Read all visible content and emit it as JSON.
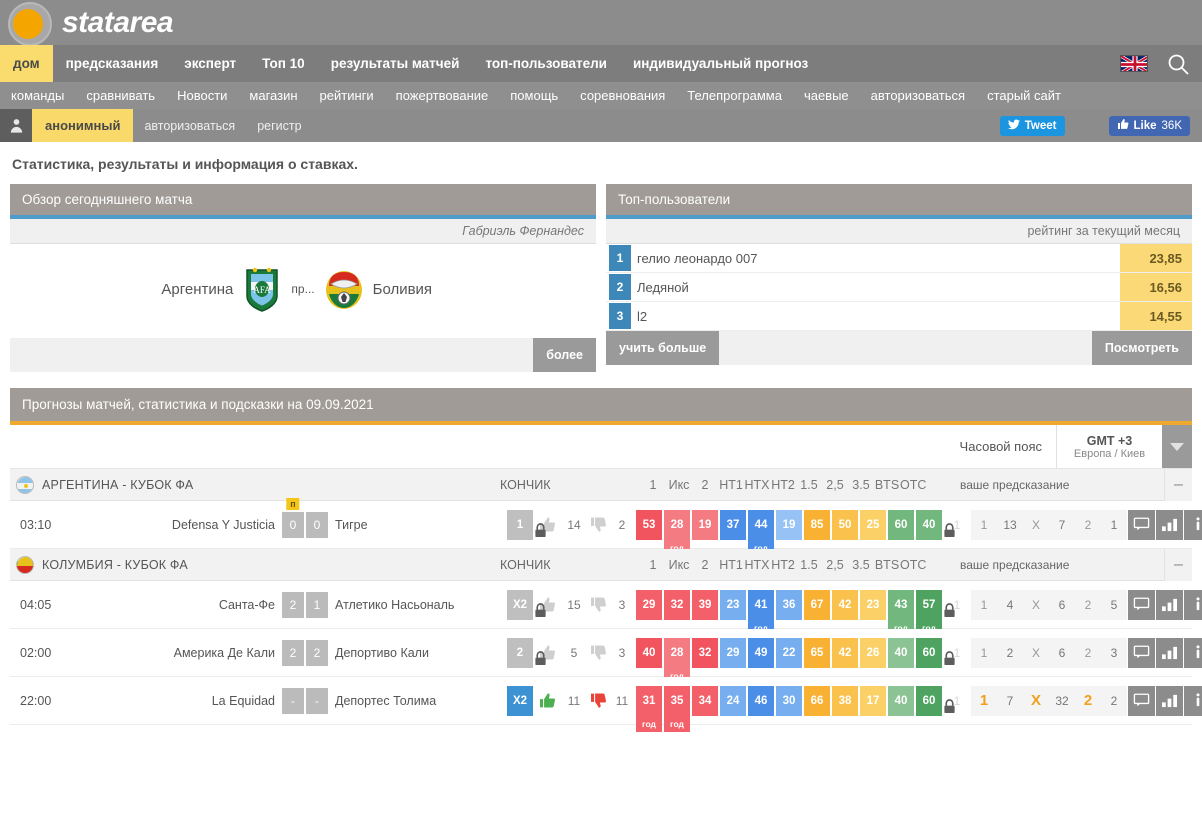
{
  "brand": {
    "name": "statarea"
  },
  "nav_primary": [
    {
      "label": "дом",
      "active": true
    },
    {
      "label": "предсказания",
      "active": false
    },
    {
      "label": "эксперт",
      "active": false
    },
    {
      "label": "Топ 10",
      "active": false
    },
    {
      "label": "результаты матчей",
      "active": false
    },
    {
      "label": "топ-пользователи",
      "active": false
    },
    {
      "label": "индивидуальный прогноз",
      "active": false
    }
  ],
  "nav_secondary": [
    {
      "label": "команды"
    },
    {
      "label": "сравнивать"
    },
    {
      "label": "Новости"
    },
    {
      "label": "магазин"
    },
    {
      "label": "рейтинги"
    },
    {
      "label": "пожертвование"
    },
    {
      "label": "помощь"
    },
    {
      "label": "соревнования"
    },
    {
      "label": "Телепрограмма"
    },
    {
      "label": "чаевые"
    },
    {
      "label": "авторизоваться"
    },
    {
      "label": "старый сайт"
    }
  ],
  "userbar": {
    "username": "анонимный",
    "login": "авторизоваться",
    "register": "регистр",
    "tweet": "Tweet",
    "like": "Like",
    "like_count": "36K"
  },
  "page_title": "Статистика, результаты и информация о ставках.",
  "match_overview": {
    "title": "Обзор сегодняшнего матча",
    "referee": "Габриэль Фернандес",
    "home": "Аргентина",
    "away": "Боливия",
    "vs": "пр...",
    "more_button": "более"
  },
  "top_users": {
    "title": "Топ-пользователи",
    "subtitle": "рейтинг за текущий месяц",
    "rows": [
      {
        "rank": "1",
        "name": "гелио леонардо 007",
        "value": "23,85"
      },
      {
        "rank": "2",
        "name": "Ледяной",
        "value": "16,56"
      },
      {
        "rank": "3",
        "name": "l2",
        "value": "14,55"
      }
    ],
    "learn_more": "учить больше",
    "view_button": "Посмотреть"
  },
  "predictions": {
    "title": "Прогнозы матчей, статистика и подсказки на 09.09.2021",
    "timezone_label": "Часовой пояс",
    "timezone_value": "GMT +3",
    "timezone_zone": "Европа / Киев",
    "columns": [
      "1",
      "Икс",
      "2",
      "HT1",
      "HTX",
      "HT2",
      "1.5",
      "2,5",
      "3.5",
      "BTS",
      "OTC"
    ],
    "tip_header": "КОНЧИК",
    "your_prediction": "ваше предсказание",
    "collapse": "–",
    "leagues": [
      {
        "name": "АРГЕНТИНА - КУБОК ФА",
        "flag": "argentina",
        "matches": [
          {
            "time": "03:10",
            "home": "Defensa Y Justicia",
            "away": "Тигре",
            "score_home": "0",
            "score_away": "0",
            "penalty": "п",
            "tip": "1",
            "tip_style": "grey",
            "locked": true,
            "up_votes": "14",
            "down_votes": "2",
            "probs": [
              {
                "v": "53",
                "c": "p-red2",
                "god": ""
              },
              {
                "v": "28",
                "c": "p-redl",
                "god": "год"
              },
              {
                "v": "19",
                "c": "p-redl",
                "god": ""
              },
              {
                "v": "37",
                "c": "p-blu2",
                "god": ""
              },
              {
                "v": "44",
                "c": "p-blu2",
                "god": "год"
              },
              {
                "v": "19",
                "c": "p-blu3",
                "god": ""
              },
              {
                "v": "85",
                "c": "p-org1",
                "god": ""
              },
              {
                "v": "50",
                "c": "p-org2",
                "god": ""
              },
              {
                "v": "25",
                "c": "p-org3",
                "god": ""
              },
              {
                "v": "60",
                "c": "p-grn1",
                "god": ""
              },
              {
                "v": "40",
                "c": "p-grn1",
                "god": ""
              }
            ],
            "votes": [
              {
                "label": "1",
                "num": "13",
                "strong": false
              },
              {
                "label": "X",
                "num": "7",
                "strong": false
              },
              {
                "label": "2",
                "num": "1",
                "strong": false
              }
            ]
          }
        ]
      },
      {
        "name": "КОЛУМБИЯ - КУБОК ФА",
        "flag": "colombia",
        "matches": [
          {
            "time": "04:05",
            "home": "Санта-Фе",
            "away": "Атлетико Насьональ",
            "score_home": "2",
            "score_away": "1",
            "penalty": "",
            "tip": "X2",
            "tip_style": "grey",
            "locked": true,
            "up_votes": "15",
            "down_votes": "3",
            "probs": [
              {
                "v": "29",
                "c": "p-red1",
                "god": ""
              },
              {
                "v": "32",
                "c": "p-red1",
                "god": ""
              },
              {
                "v": "39",
                "c": "p-red1",
                "god": ""
              },
              {
                "v": "23",
                "c": "p-blu1",
                "god": ""
              },
              {
                "v": "41",
                "c": "p-blu2",
                "god": "год"
              },
              {
                "v": "36",
                "c": "p-blu1",
                "god": ""
              },
              {
                "v": "67",
                "c": "p-org1",
                "god": ""
              },
              {
                "v": "42",
                "c": "p-org2",
                "god": ""
              },
              {
                "v": "23",
                "c": "p-org3",
                "god": ""
              },
              {
                "v": "43",
                "c": "p-grn1",
                "god": "год"
              },
              {
                "v": "57",
                "c": "p-grn2",
                "god": "год"
              }
            ],
            "votes": [
              {
                "label": "1",
                "num": "4",
                "strong": false
              },
              {
                "label": "X",
                "num": "6",
                "strong": false
              },
              {
                "label": "2",
                "num": "5",
                "strong": false
              }
            ]
          },
          {
            "time": "02:00",
            "home": "Америка Де Кали",
            "away": "Депортиво Кали",
            "score_home": "2",
            "score_away": "2",
            "penalty": "",
            "tip": "2",
            "tip_style": "grey",
            "locked": true,
            "up_votes": "5",
            "down_votes": "3",
            "probs": [
              {
                "v": "40",
                "c": "p-red2",
                "god": ""
              },
              {
                "v": "28",
                "c": "p-redl",
                "god": "год"
              },
              {
                "v": "32",
                "c": "p-red2",
                "god": ""
              },
              {
                "v": "29",
                "c": "p-blu1",
                "god": ""
              },
              {
                "v": "49",
                "c": "p-blu2",
                "god": ""
              },
              {
                "v": "22",
                "c": "p-blu1",
                "god": ""
              },
              {
                "v": "65",
                "c": "p-org1",
                "god": ""
              },
              {
                "v": "42",
                "c": "p-org2",
                "god": ""
              },
              {
                "v": "26",
                "c": "p-org3",
                "god": ""
              },
              {
                "v": "40",
                "c": "p-grn3",
                "god": ""
              },
              {
                "v": "60",
                "c": "p-grn2",
                "god": ""
              }
            ],
            "votes": [
              {
                "label": "1",
                "num": "2",
                "strong": false
              },
              {
                "label": "X",
                "num": "6",
                "strong": false
              },
              {
                "label": "2",
                "num": "3",
                "strong": false
              }
            ]
          },
          {
            "time": "22:00",
            "home": "La Equidad",
            "away": "Депортес Толима",
            "score_home": "-",
            "score_away": "-",
            "penalty": "",
            "tip": "X2",
            "tip_style": "blue",
            "locked": false,
            "up_votes": "11",
            "down_votes": "11",
            "probs": [
              {
                "v": "31",
                "c": "p-red1",
                "god": "год"
              },
              {
                "v": "35",
                "c": "p-red1",
                "god": "год"
              },
              {
                "v": "34",
                "c": "p-red1",
                "god": ""
              },
              {
                "v": "24",
                "c": "p-blu1",
                "god": ""
              },
              {
                "v": "46",
                "c": "p-blu2",
                "god": ""
              },
              {
                "v": "30",
                "c": "p-blu1",
                "god": ""
              },
              {
                "v": "66",
                "c": "p-org1",
                "god": ""
              },
              {
                "v": "38",
                "c": "p-org2",
                "god": ""
              },
              {
                "v": "17",
                "c": "p-org3",
                "god": ""
              },
              {
                "v": "40",
                "c": "p-grn3",
                "god": ""
              },
              {
                "v": "60",
                "c": "p-grn2",
                "god": ""
              }
            ],
            "votes": [
              {
                "label": "1",
                "num": "7",
                "strong": true
              },
              {
                "label": "X",
                "num": "32",
                "strong": true
              },
              {
                "label": "2",
                "num": "2",
                "strong": true
              }
            ]
          }
        ]
      }
    ]
  },
  "colors": {
    "accent_orange": "#efa92e",
    "accent_blue": "#4d9cc9",
    "brand_yellow": "#f9dc6d",
    "header_grey": "#8c8c8c"
  }
}
